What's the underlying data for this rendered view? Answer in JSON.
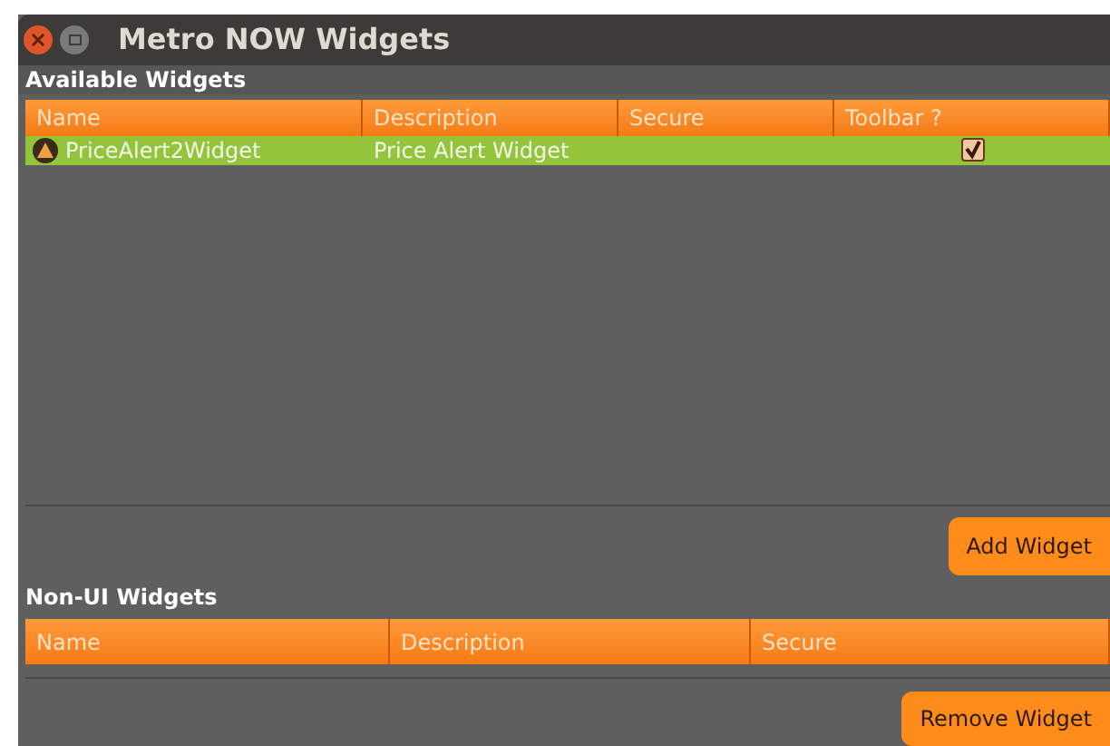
{
  "window": {
    "title": "Metro NOW Widgets"
  },
  "available_widgets": {
    "title": "Available Widgets",
    "columns": [
      "Name",
      "Description",
      "Secure",
      "Toolbar ?"
    ],
    "rows": [
      {
        "name": "PriceAlert2Widget",
        "description": "Price Alert Widget",
        "toolbar": true,
        "selected": true
      }
    ]
  },
  "add_button": "Add Widget",
  "non_ui_widgets": {
    "title": "Non-UI Widgets",
    "columns": [
      "Name",
      "Description",
      "Secure"
    ]
  },
  "remove_button": "Remove Widget"
}
